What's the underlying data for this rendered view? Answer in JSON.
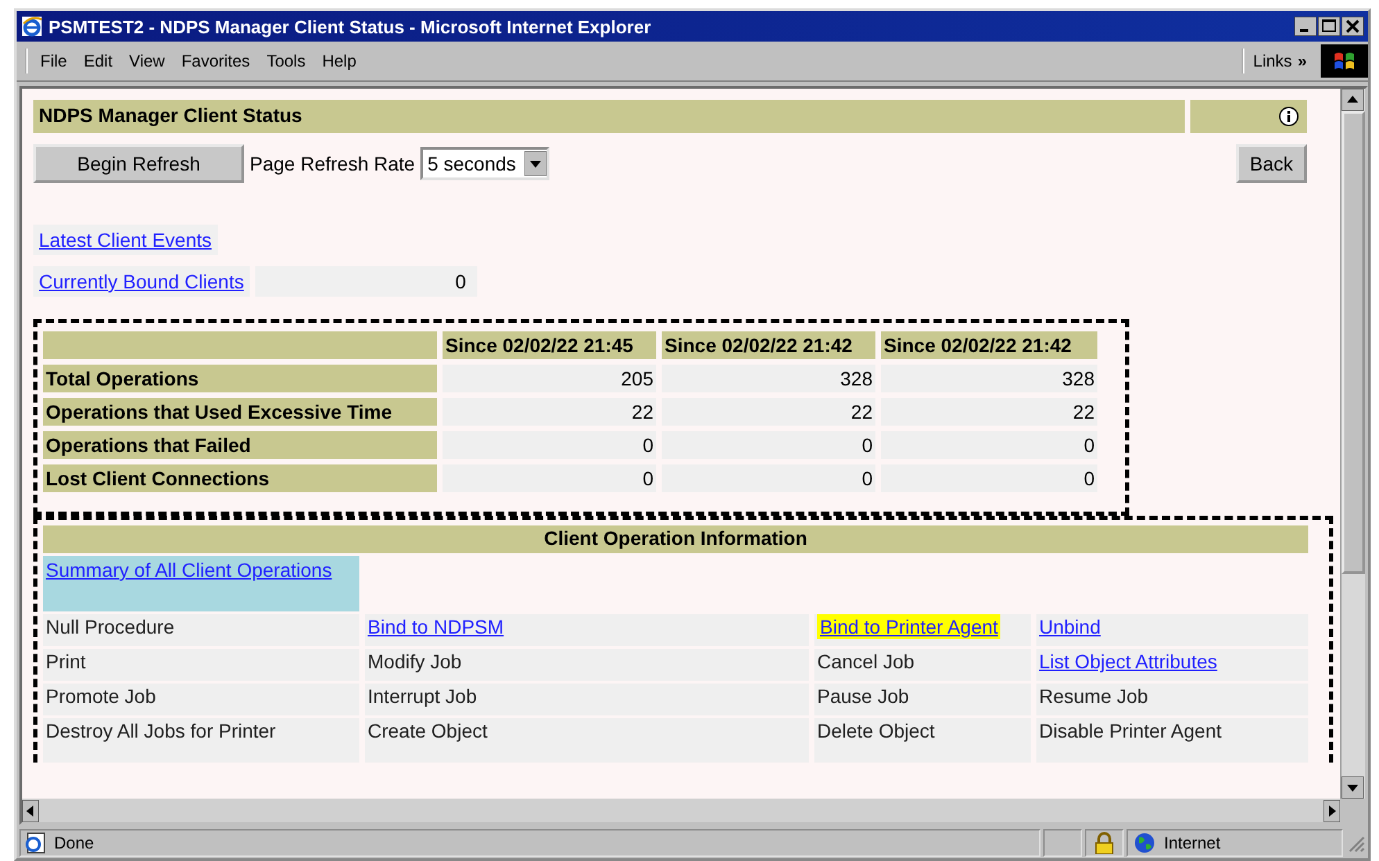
{
  "window": {
    "title": "PSMTEST2 - NDPS Manager Client Status - Microsoft Internet Explorer"
  },
  "menu": [
    {
      "label": "File"
    },
    {
      "label": "Edit"
    },
    {
      "label": "View"
    },
    {
      "label": "Favorites"
    },
    {
      "label": "Tools"
    },
    {
      "label": "Help"
    }
  ],
  "links_bar": {
    "label": "Links",
    "chevron": "»"
  },
  "page": {
    "title": "NDPS Manager Client Status",
    "refresh_button": "Begin Refresh",
    "refresh_rate_label": "Page Refresh Rate",
    "refresh_rate_value": "5 seconds",
    "back_button": "Back",
    "links": [
      {
        "label": "Latest Client Events"
      },
      {
        "label": "Currently Bound Clients",
        "value": "0"
      }
    ],
    "stats": {
      "columns": [
        "Since 02/02/22 21:45",
        "Since 02/02/22 21:42",
        "Since 02/02/22 21:42"
      ],
      "rows": [
        {
          "label": "Total Operations",
          "values": [
            "205",
            "328",
            "328"
          ]
        },
        {
          "label": "Operations that Used Excessive Time",
          "values": [
            "22",
            "22",
            "22"
          ]
        },
        {
          "label": "Operations that Failed",
          "values": [
            "0",
            "0",
            "0"
          ]
        },
        {
          "label": "Lost Client Connections",
          "values": [
            "0",
            "0",
            "0"
          ]
        }
      ]
    },
    "operations": {
      "title": "Client Operation Information",
      "summary": {
        "label": "Summary of All Client Operations",
        "color": "#a8d8e0"
      },
      "rows": [
        [
          {
            "label": "Null Procedure",
            "kind": "text"
          },
          {
            "label": "Bind to NDPSM",
            "kind": "link"
          },
          {
            "label": "Bind to Printer Agent",
            "kind": "link",
            "color": "#ffff00"
          },
          {
            "label": "Unbind",
            "kind": "link"
          }
        ],
        [
          {
            "label": "Print",
            "kind": "text"
          },
          {
            "label": "Modify Job",
            "kind": "text"
          },
          {
            "label": "Cancel Job",
            "kind": "text"
          },
          {
            "label": "List Object Attributes",
            "kind": "link"
          }
        ],
        [
          {
            "label": "Promote Job",
            "kind": "text"
          },
          {
            "label": "Interrupt Job",
            "kind": "text"
          },
          {
            "label": "Pause Job",
            "kind": "text"
          },
          {
            "label": "Resume Job",
            "kind": "text"
          }
        ],
        [
          {
            "label": "Destroy All Jobs for Printer",
            "kind": "text"
          },
          {
            "label": "Create Object",
            "kind": "text"
          },
          {
            "label": "Delete Object",
            "kind": "text"
          },
          {
            "label": "Disable Printer Agent",
            "kind": "text"
          }
        ]
      ]
    }
  },
  "status_bar": {
    "text": "Done",
    "zone": "Internet"
  }
}
